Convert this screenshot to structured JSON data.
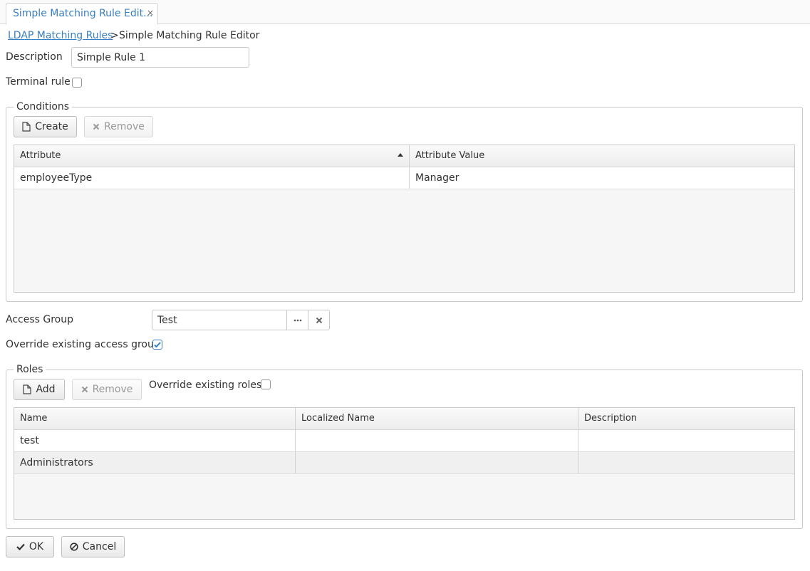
{
  "tab": {
    "title": "Simple Matching Rule Edit...",
    "close": "×"
  },
  "breadcrumb": {
    "parent": "LDAP Matching Rules",
    "separator": ">",
    "current": "Simple Matching Rule Editor"
  },
  "form": {
    "description_label": "Description",
    "description_value": "Simple Rule 1",
    "terminal_label": "Terminal rule",
    "terminal_checked": false,
    "access_group_label": "Access Group",
    "access_group_value": "Test",
    "override_access_label": "Override existing access group",
    "override_access_checked": true
  },
  "conditions": {
    "legend": "Conditions",
    "create_label": "Create",
    "remove_label": "Remove",
    "columns": [
      "Attribute",
      "Attribute Value"
    ],
    "rows": [
      [
        "employeeType",
        "Manager"
      ]
    ]
  },
  "roles": {
    "legend": "Roles",
    "add_label": "Add",
    "remove_label": "Remove",
    "override_label": "Override existing roles",
    "override_checked": false,
    "columns": [
      "Name",
      "Localized Name",
      "Description"
    ],
    "rows": [
      [
        "test",
        "",
        ""
      ],
      [
        "Administrators",
        "",
        ""
      ]
    ]
  },
  "footer": {
    "ok_label": "OK",
    "cancel_label": "Cancel"
  },
  "colors": {
    "accent": "#3a7fc1",
    "border": "#c8c8c8"
  }
}
